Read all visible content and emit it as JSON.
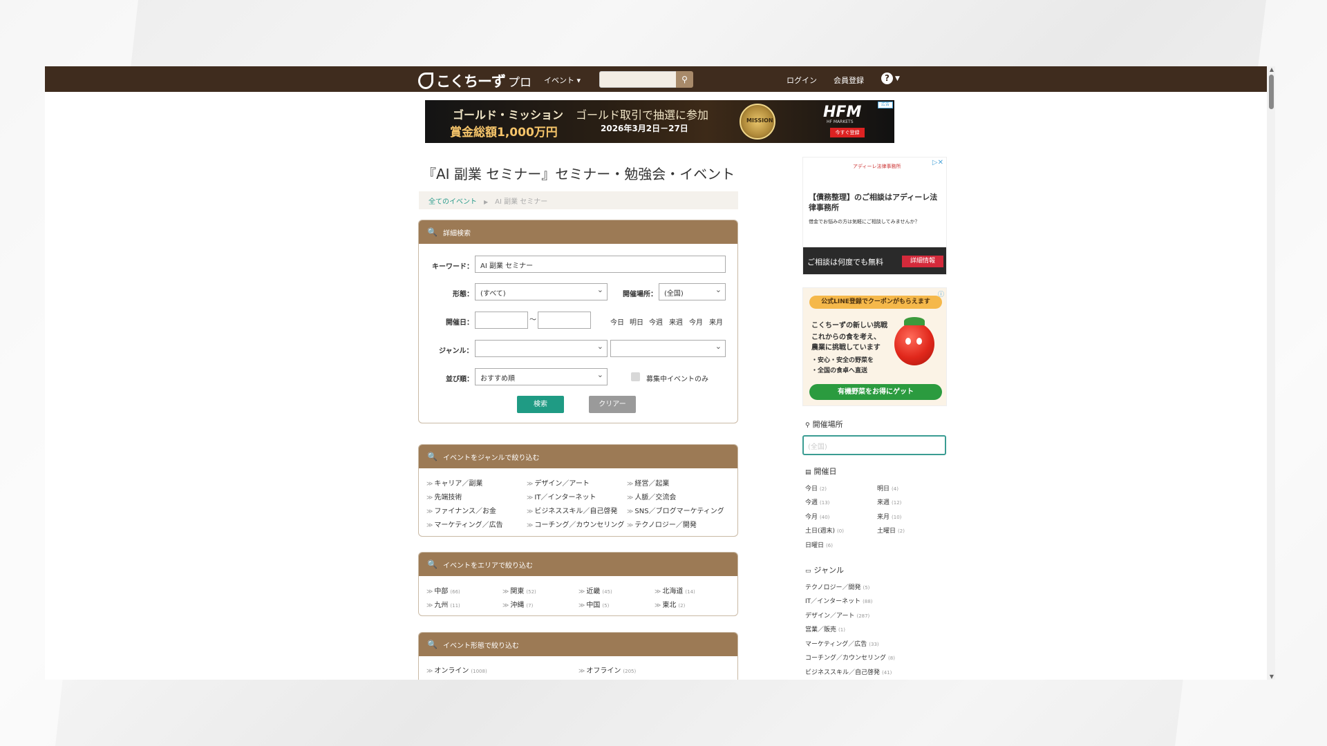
{
  "header": {
    "logo_text": "こくちーず",
    "logo_sub": "プロ",
    "nav_event": "イベント ▾",
    "search_placeholder": "",
    "login": "ログイン",
    "register": "会員登録",
    "help": "?",
    "brand_color": "#3f2c1e"
  },
  "banner_ad": {
    "line1": "ゴールド・ミッション",
    "line2": "賞金総額1,000万円",
    "line3": "ゴールド取引で抽選に参加",
    "line4": "2026年3月2日－27日",
    "medal": "MISSION",
    "brand": "HFM",
    "brand_sub": "HF MARKETS",
    "cta": "今すぐ登録",
    "badge": "広告"
  },
  "page": {
    "title": "『AI 副業 セミナー』セミナー・勉強会・イベント",
    "breadcrumb": [
      {
        "label": "全てのイベント"
      },
      {
        "label": "AI 副業 セミナー"
      }
    ]
  },
  "search_panel": {
    "heading": "詳細検索",
    "keyword_label": "キーワード：",
    "keyword_value": "AI 副業 セミナー",
    "format_label": "形態：",
    "format_value": "(すべて)",
    "location_label": "開催場所：",
    "location_value": "(全国)",
    "date_label": "開催日：",
    "date_sep": "〜",
    "quick_dates": [
      "今日",
      "明日",
      "今週",
      "来週",
      "今月",
      "来月"
    ],
    "genre_label": "ジャンル：",
    "sort_label": "並び順：",
    "sort_value": "おすすめ順",
    "recruiting_label": "募集中イベントのみ",
    "search_btn": "検索",
    "clear_btn": "クリアー",
    "accent_color": "#1f9b84"
  },
  "genre_panel": {
    "heading": "イベントをジャンルで絞り込む",
    "items": [
      "キャリア／副業",
      "デザイン／アート",
      "経営／起業",
      "先端技術",
      "IT／インターネット",
      "人脈／交流会",
      "ファイナンス／お金",
      "ビジネススキル／自己啓発",
      "SNS／ブログマーケティング",
      "マーケティング／広告",
      "コーチング／カウンセリング",
      "テクノロジー／開発"
    ]
  },
  "area_panel": {
    "heading": "イベントをエリアで絞り込む",
    "items": [
      {
        "label": "中部",
        "count": "(66)"
      },
      {
        "label": "関東",
        "count": "(52)"
      },
      {
        "label": "近畿",
        "count": "(45)"
      },
      {
        "label": "北海道",
        "count": "(14)"
      },
      {
        "label": "九州",
        "count": "(11)"
      },
      {
        "label": "沖縄",
        "count": "(7)"
      },
      {
        "label": "中国",
        "count": "(5)"
      },
      {
        "label": "東北",
        "count": "(2)"
      }
    ]
  },
  "format_panel": {
    "heading": "イベント形態で絞り込む",
    "items": [
      {
        "label": "オンライン",
        "count": "(1008)"
      },
      {
        "label": "オフライン",
        "count": "(205)"
      }
    ]
  },
  "side_ad1": {
    "sponsor": "アディーレ法律事務所",
    "title": "【債務整理】のご相談はアディーレ法律事務所",
    "desc": "借金でお悩みの方は気軽にご相談してみませんか？",
    "footer": "ご相談は何度でも無料",
    "cta": "詳細情報"
  },
  "side_ad2": {
    "top": "公式LINE登録でクーポンがもらえます",
    "h1": "こくちーずの新しい挑戦",
    "h2": "これからの食を考え、",
    "h3": "農業に挑戦しています",
    "b1": "・安心・安全の野菜を",
    "b2": "・全国の食卓へ直送",
    "cta": "有機野菜をお得にゲット"
  },
  "sidebar": {
    "location_heading": "開催場所",
    "location_placeholder": "(全国)",
    "date_heading": "開催日",
    "dates": [
      {
        "label": "今日",
        "count": "(2)"
      },
      {
        "label": "明日",
        "count": "(4)"
      },
      {
        "label": "今週",
        "count": "(13)"
      },
      {
        "label": "来週",
        "count": "(12)"
      },
      {
        "label": "今月",
        "count": "(40)"
      },
      {
        "label": "来月",
        "count": "(10)"
      },
      {
        "label": "土日(週末)",
        "count": "(0)"
      },
      {
        "label": "土曜日",
        "count": "(2)"
      },
      {
        "label": "日曜日",
        "count": "(6)"
      }
    ],
    "genre_heading": "ジャンル",
    "genres": [
      {
        "label": "テクノロジー／開発",
        "count": "(5)"
      },
      {
        "label": "IT／インターネット",
        "count": "(88)"
      },
      {
        "label": "デザイン／アート",
        "count": "(287)"
      },
      {
        "label": "営業／販売",
        "count": "(1)"
      },
      {
        "label": "マーケティング／広告",
        "count": "(33)"
      },
      {
        "label": "コーチング／カウンセリング",
        "count": "(8)"
      },
      {
        "label": "ビジネススキル／自己啓発",
        "count": "(41)"
      }
    ]
  }
}
